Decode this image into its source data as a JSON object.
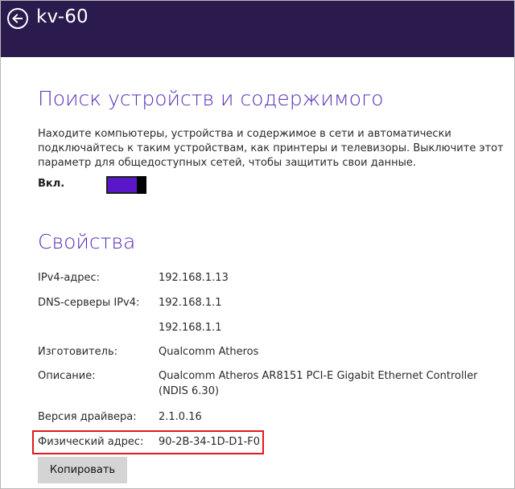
{
  "header": {
    "title": "kv-60"
  },
  "discovery": {
    "title": "Поиск устройств и содержимого",
    "description": "Находите компьютеры, устройства и содержимое в сети и автоматически подключайтесь к таким устройствам, как принтеры и телевизоры. Выключите этот параметр для общедоступных сетей, чтобы защитить свои данные.",
    "toggle_label": "Вкл.",
    "toggle_on": true
  },
  "properties": {
    "title": "Свойства",
    "ipv4_label": "IPv4-адрес:",
    "ipv4_value": "192.168.1.13",
    "dns_label": "DNS-серверы IPv4:",
    "dns_value_1": "192.168.1.1",
    "dns_value_2": "192.168.1.1",
    "manufacturer_label": "Изготовитель:",
    "manufacturer_value": "Qualcomm Atheros",
    "description_label": "Описание:",
    "description_value": "Qualcomm Atheros AR8151 PCI-E Gigabit Ethernet Controller (NDIS 6.30)",
    "driver_label": "Версия драйвера:",
    "driver_value": "2.1.0.16",
    "mac_label": "Физический адрес:",
    "mac_value": "90-2B-34-1D-D1-F0",
    "copy_button": "Копировать"
  },
  "colors": {
    "header_bg": "#2b1a4d",
    "accent": "#5a2eb8",
    "toggle_fill": "#5a17c9",
    "highlight": "#e11919"
  }
}
